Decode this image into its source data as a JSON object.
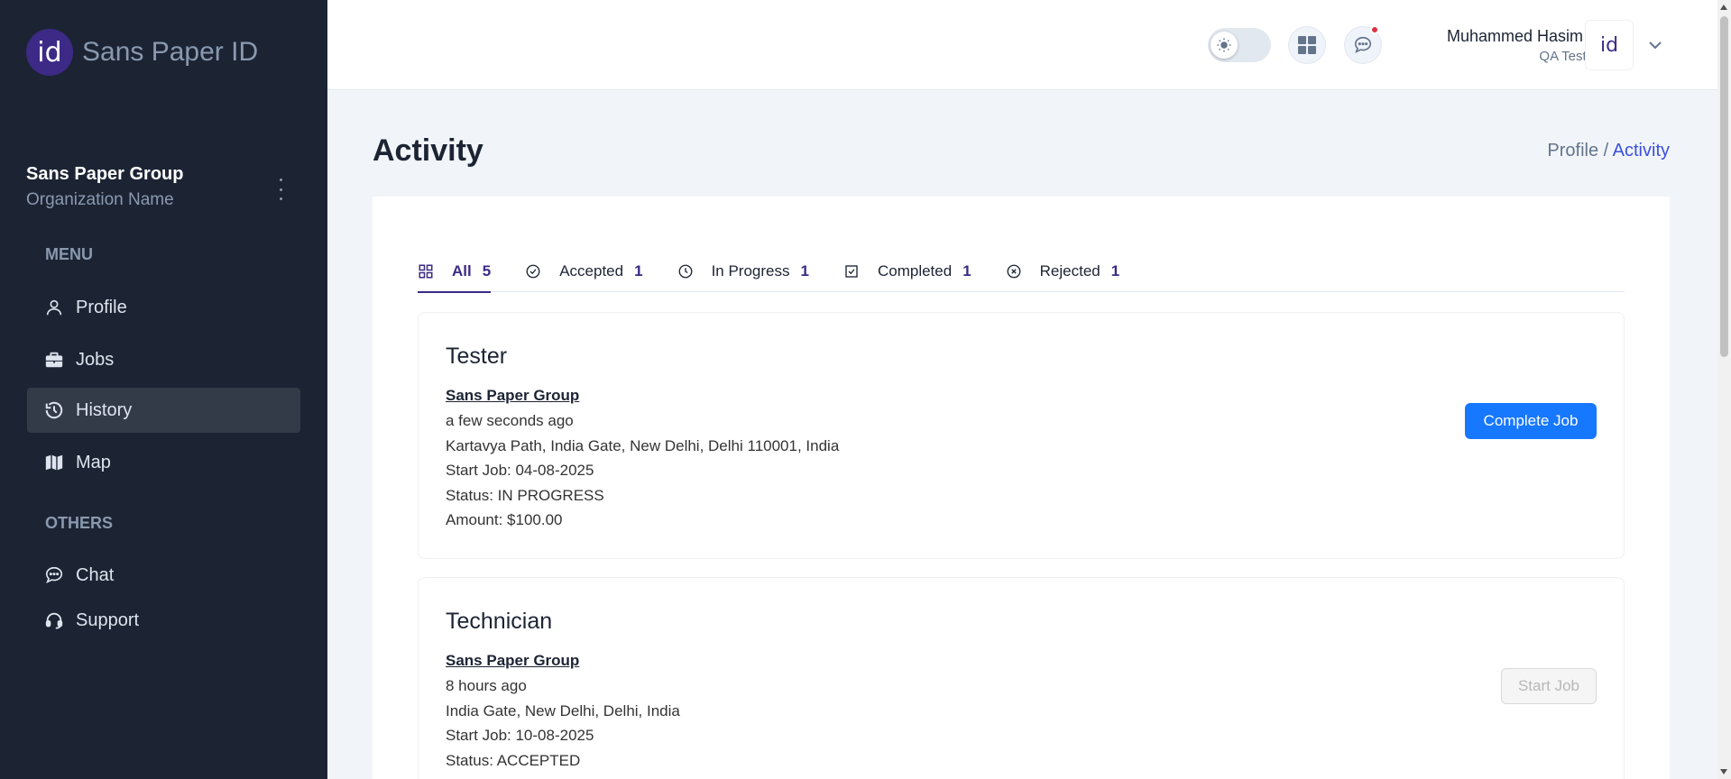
{
  "brand": {
    "logo_text": "id",
    "name": "Sans Paper ID"
  },
  "org": {
    "name": "Sans Paper Group",
    "subtitle": "Organization Name"
  },
  "sidebar": {
    "menu_title": "MENU",
    "others_title": "OTHERS",
    "items": [
      {
        "label": "Profile",
        "icon": "user-icon"
      },
      {
        "label": "Jobs",
        "icon": "briefcase-icon"
      },
      {
        "label": "History",
        "icon": "history-icon",
        "active": true
      },
      {
        "label": "Map",
        "icon": "map-icon"
      }
    ],
    "others": [
      {
        "label": "Chat",
        "icon": "chat-icon"
      },
      {
        "label": "Support",
        "icon": "headset-icon"
      }
    ]
  },
  "header": {
    "user_name": "Muhammed Hasim S",
    "user_role": "QA Tester",
    "avatar_text": "id"
  },
  "page": {
    "title": "Activity",
    "breadcrumb": {
      "parent": "Profile /",
      "current": "Activity"
    }
  },
  "tabs": [
    {
      "label": "All",
      "count": "5",
      "icon": "grid-icon",
      "active": true
    },
    {
      "label": "Accepted",
      "count": "1",
      "icon": "check-circle-icon"
    },
    {
      "label": "In Progress",
      "count": "1",
      "icon": "clock-icon"
    },
    {
      "label": "Completed",
      "count": "1",
      "icon": "checkbox-icon"
    },
    {
      "label": "Rejected",
      "count": "1",
      "icon": "x-circle-icon"
    }
  ],
  "jobs": [
    {
      "title": "Tester",
      "company": "Sans Paper Group",
      "time": "a few seconds ago",
      "address": "Kartavya Path, India Gate, New Delhi, Delhi 110001, India",
      "start": "Start Job: 04-08-2025",
      "status": "Status: IN PROGRESS",
      "amount": "Amount: $100.00",
      "action": "Complete Job"
    },
    {
      "title": "Technician",
      "company": "Sans Paper Group",
      "time": "8 hours ago",
      "address": "India Gate, New Delhi, Delhi, India",
      "start": "Start Job: 10-08-2025",
      "status": "Status: ACCEPTED",
      "action": "Start Job"
    }
  ],
  "colors": {
    "sidebar": "#1c2434",
    "accent": "#3c2a86",
    "primary_button": "#1677ff"
  }
}
